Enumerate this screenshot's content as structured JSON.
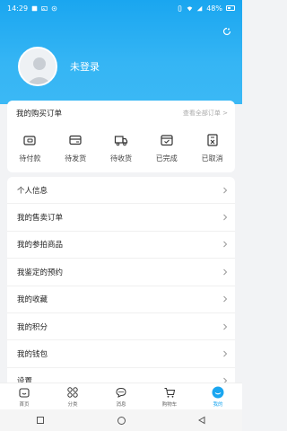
{
  "status_bar": {
    "time": "14:29",
    "battery_text": "48%"
  },
  "profile": {
    "login_text": "未登录",
    "settings_icon": "refresh-settings-icon"
  },
  "orders": {
    "title": "我的购买订单",
    "view_all": "查看全部订单 >",
    "items": [
      {
        "label": "待付款",
        "icon": "wallet-icon"
      },
      {
        "label": "待发货",
        "icon": "card-icon"
      },
      {
        "label": "待收货",
        "icon": "truck-icon"
      },
      {
        "label": "已完成",
        "icon": "box-check-icon"
      },
      {
        "label": "已取消",
        "icon": "doc-cancel-icon"
      }
    ]
  },
  "menu": [
    {
      "label": "个人信息"
    },
    {
      "label": "我的售卖订单"
    },
    {
      "label": "我的参拍商品"
    },
    {
      "label": "我鉴定的预约"
    },
    {
      "label": "我的收藏"
    },
    {
      "label": "我的积分"
    },
    {
      "label": "我的钱包"
    },
    {
      "label": "设置"
    }
  ],
  "tabbar": {
    "items": [
      {
        "label": "首页",
        "icon": "home-icon"
      },
      {
        "label": "分类",
        "icon": "grid-icon"
      },
      {
        "label": "消息",
        "icon": "message-icon"
      },
      {
        "label": "购物车",
        "icon": "cart-icon"
      },
      {
        "label": "我的",
        "icon": "user-icon",
        "active": true
      }
    ]
  },
  "colors": {
    "accent": "#1aa6f0",
    "background": "#f2f3f5"
  }
}
